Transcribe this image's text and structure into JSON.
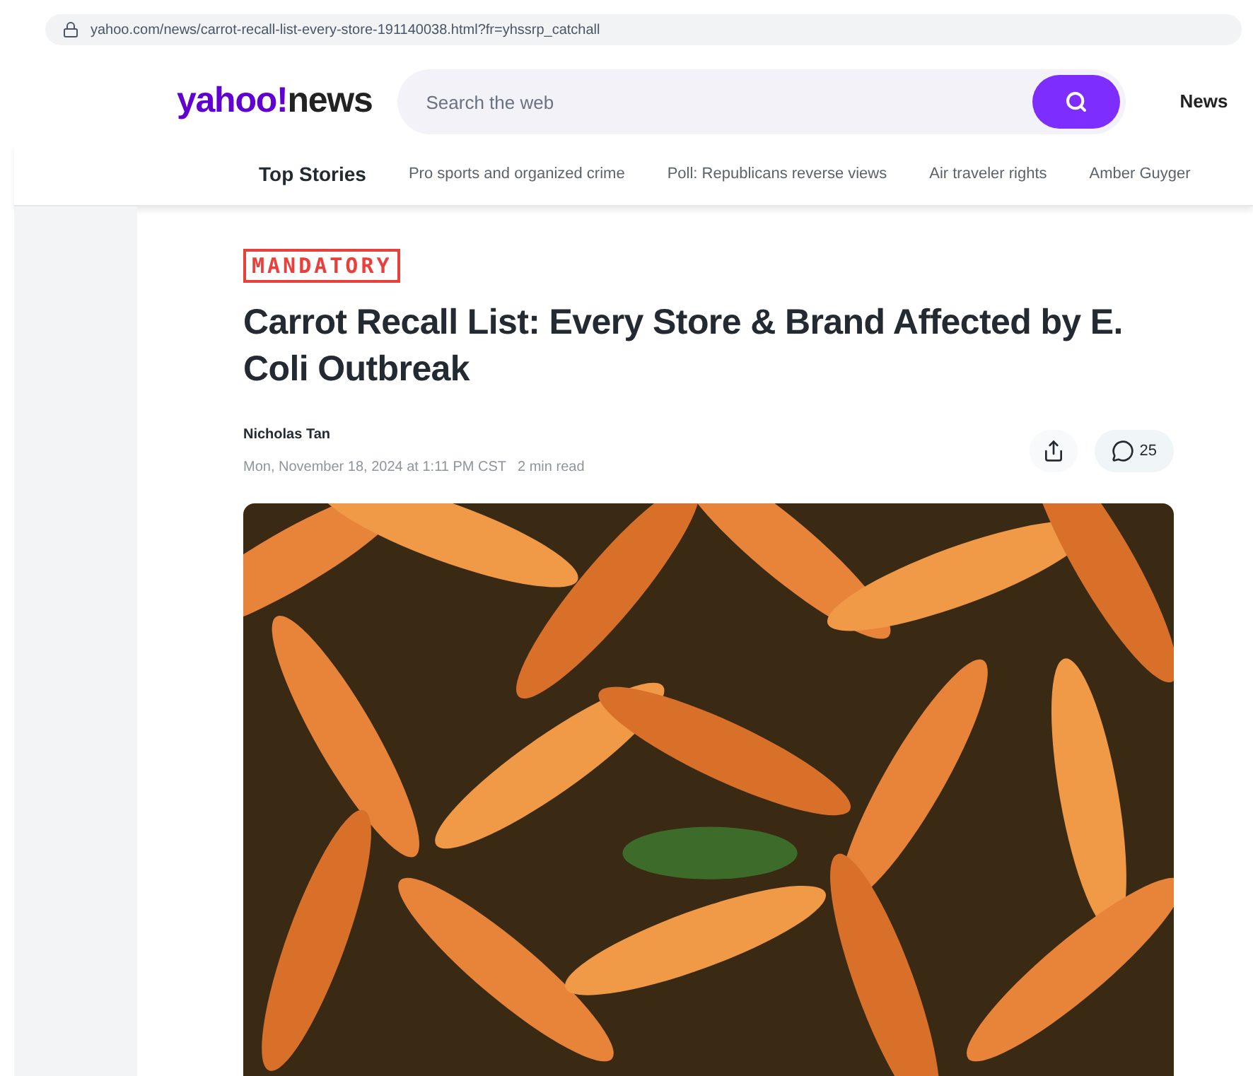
{
  "address_bar": {
    "url": "yahoo.com/news/carrot-recall-list-every-store-191140038.html?fr=yhssrp_catchall"
  },
  "header": {
    "logo": {
      "brand": "yahoo!",
      "section": "news"
    },
    "search": {
      "placeholder": "Search the web"
    },
    "nav_link": "News"
  },
  "topics": [
    {
      "label": "Top Stories",
      "selected": true
    },
    {
      "label": "Pro sports and organized crime",
      "selected": false
    },
    {
      "label": "Poll: Republicans reverse views",
      "selected": false
    },
    {
      "label": "Air traveler rights",
      "selected": false
    },
    {
      "label": "Amber Guyger",
      "selected": false
    }
  ],
  "article": {
    "tag": "MANDATORY",
    "title": "Carrot Recall List: Every Store & Brand Affected by E. Coli Outbreak",
    "author": "Nicholas Tan",
    "date": "Mon, November 18, 2024 at 1:11 PM CST",
    "read_time": "2 min read",
    "comments": "25"
  }
}
